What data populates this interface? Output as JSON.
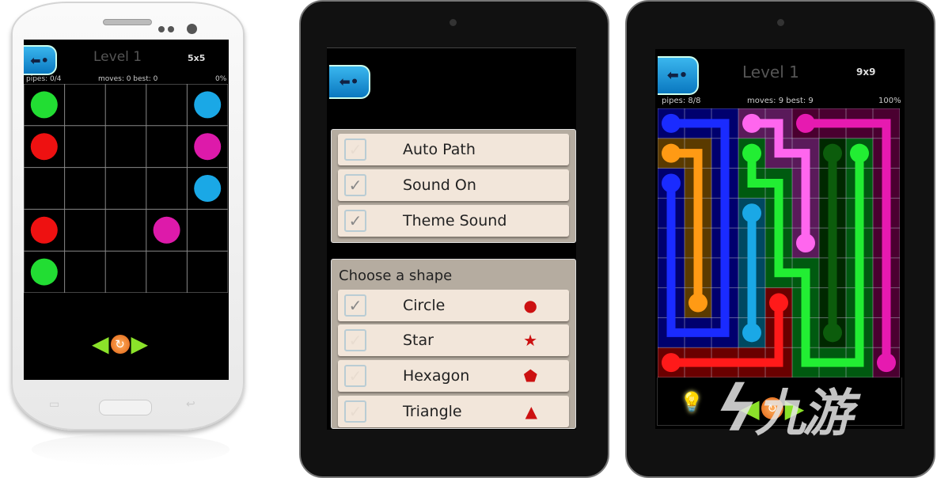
{
  "screen1": {
    "title": "Level 1",
    "size": "5x5",
    "pipes": "pipes: 0/4",
    "moves": "moves: 0 best: 0",
    "percent": "0%",
    "grid": {
      "cols": 5,
      "rows": 5,
      "dots": [
        {
          "col": 0,
          "row": 0,
          "color": "#22dd33"
        },
        {
          "col": 4,
          "row": 0,
          "color": "#1aa8e6"
        },
        {
          "col": 0,
          "row": 1,
          "color": "#ee1111"
        },
        {
          "col": 4,
          "row": 1,
          "color": "#dd1aaa"
        },
        {
          "col": 4,
          "row": 2,
          "color": "#1aa8e6"
        },
        {
          "col": 0,
          "row": 3,
          "color": "#ee1111"
        },
        {
          "col": 3,
          "row": 3,
          "color": "#dd1aaa"
        },
        {
          "col": 0,
          "row": 4,
          "color": "#22dd33"
        }
      ]
    },
    "controls": {
      "prev": "◀",
      "reload": "↻",
      "next": "▶"
    }
  },
  "screen2": {
    "settings": [
      {
        "label": "Auto Path",
        "checked": false
      },
      {
        "label": "Sound On",
        "checked": true
      },
      {
        "label": "Theme Sound",
        "checked": true
      }
    ],
    "shape_header": "Choose a shape",
    "shapes": [
      {
        "label": "Circle",
        "checked": true,
        "glyph": "●"
      },
      {
        "label": "Star",
        "checked": false,
        "glyph": "★"
      },
      {
        "label": "Hexagon",
        "checked": false,
        "glyph": "⬟"
      },
      {
        "label": "Triangle",
        "checked": false,
        "glyph": "▲"
      }
    ]
  },
  "screen3": {
    "title": "Level 1",
    "size": "9x9",
    "pipes": "pipes: 8/8",
    "moves": "moves: 9 best: 9",
    "percent": "100%",
    "grid": {
      "cols": 9,
      "rows": 9,
      "paths": [
        {
          "color": "#1a2bff",
          "dim": "#00006e",
          "points": [
            [
              0,
              0
            ],
            [
              2,
              0
            ],
            [
              2,
              7
            ],
            [
              0,
              7
            ],
            [
              0,
              2
            ]
          ]
        },
        {
          "color": "#ff9a14",
          "dim": "#5a3a00",
          "points": [
            [
              0,
              1
            ],
            [
              1,
              1
            ],
            [
              1,
              6
            ]
          ]
        },
        {
          "color": "#ff66ee",
          "dim": "#5a1a5a",
          "points": [
            [
              3,
              0
            ],
            [
              4,
              0
            ],
            [
              4,
              1
            ],
            [
              5,
              1
            ],
            [
              5,
              4
            ]
          ]
        },
        {
          "color": "#e61ab0",
          "dim": "#4a0030",
          "points": [
            [
              5,
              0
            ],
            [
              8,
              0
            ],
            [
              8,
              8
            ]
          ]
        },
        {
          "color": "#22ee33",
          "dim": "#005a10",
          "points": [
            [
              3,
              1
            ],
            [
              3,
              2
            ],
            [
              4,
              2
            ],
            [
              4,
              5
            ],
            [
              5,
              5
            ],
            [
              5,
              8
            ],
            [
              7,
              8
            ],
            [
              7,
              1
            ]
          ]
        },
        {
          "color": "#0c5c0c",
          "dim": "#002800",
          "points": [
            [
              6,
              1
            ],
            [
              6,
              7
            ]
          ]
        },
        {
          "color": "#1aa8e6",
          "dim": "#004860",
          "points": [
            [
              3,
              3
            ],
            [
              3,
              7
            ]
          ]
        },
        {
          "color": "#ff1a1a",
          "dim": "#6a0000",
          "points": [
            [
              0,
              8
            ],
            [
              4,
              8
            ],
            [
              4,
              6
            ]
          ]
        }
      ]
    },
    "hint_icon": "lightbulb-icon",
    "controls": {
      "prev": "◀",
      "reload": "↻",
      "next": "▶"
    }
  },
  "watermark": "九游"
}
